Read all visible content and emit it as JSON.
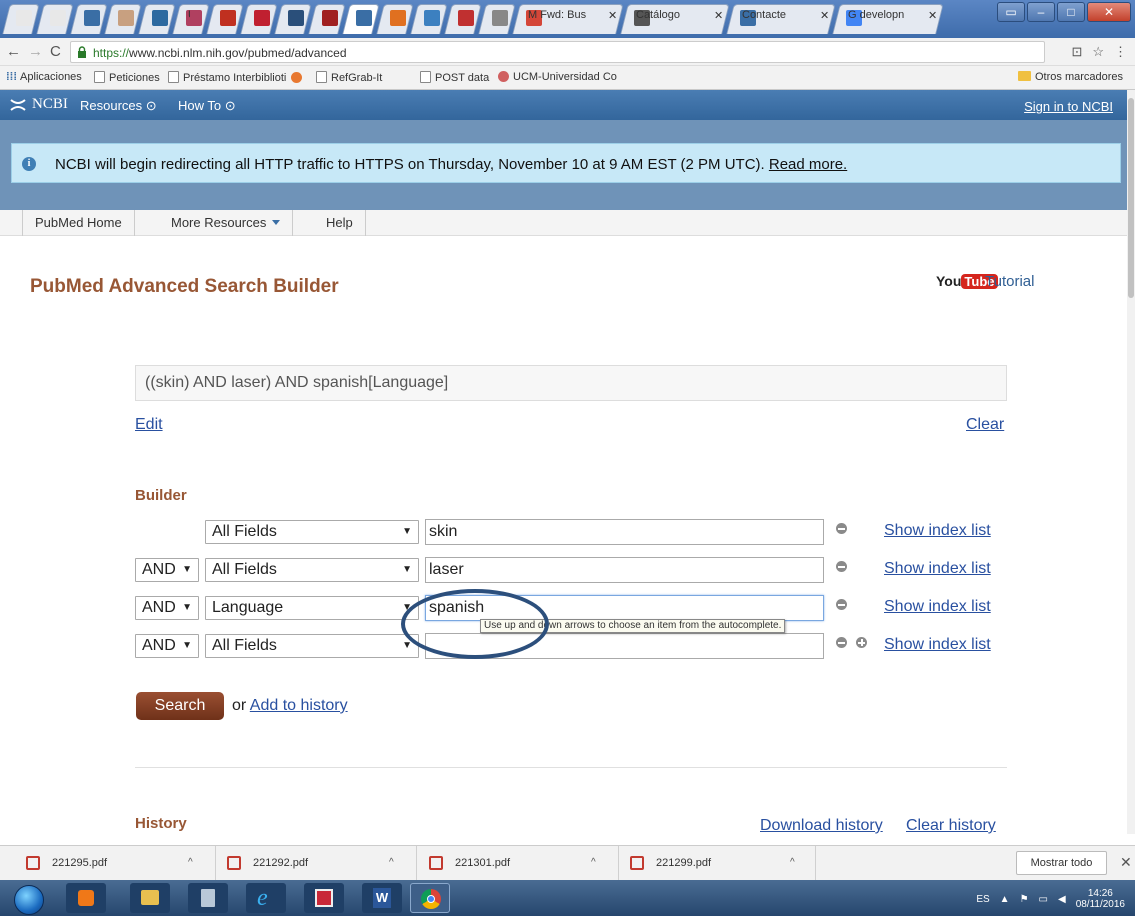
{
  "browser": {
    "tabs": [
      {
        "label": "",
        "color": "#e8e8e8"
      },
      {
        "label": "",
        "color": "#e8e8e8"
      },
      {
        "label": "",
        "color": "#3a6ea5"
      },
      {
        "label": "",
        "color": "#c8a080"
      },
      {
        "label": "",
        "color": "#2d6aa0"
      },
      {
        "label": "ULL",
        "color": "#b04060"
      },
      {
        "label": "",
        "color": "#c03020"
      },
      {
        "label": "",
        "color": "#c02030"
      },
      {
        "label": "",
        "color": "#2a4f7a"
      },
      {
        "label": "",
        "color": "#a02020"
      },
      {
        "label": "",
        "color": "#3a6ea5"
      },
      {
        "label": "",
        "color": "#e07020"
      },
      {
        "label": "",
        "color": "#3c80c0"
      },
      {
        "label": "",
        "color": "#c03030"
      },
      {
        "label": "",
        "color": "#888888"
      },
      {
        "label": "M Fwd: Bus",
        "color": "#d44638"
      },
      {
        "label": "Catálogo",
        "color": "#555555"
      },
      {
        "label": "Contacte",
        "color": "#3a6ea5"
      },
      {
        "label": "G developn",
        "color": "#4285f4"
      }
    ],
    "url_secure": "https://",
    "url_rest": "www.ncbi.nlm.nih.gov/pubmed/advanced",
    "bookmarks": {
      "apps": "Aplicaciones",
      "items": [
        "Peticiones",
        "Préstamo Interbiblioti",
        "RefGrab-It",
        "POST data",
        "UCM-Universidad Co"
      ],
      "other": "Otros marcadores"
    }
  },
  "ncbi": {
    "logo": "NCBI",
    "resources": "Resources",
    "howto": "How To",
    "signin": "Sign in to NCBI",
    "alert_text": "NCBI will begin redirecting all HTTP traffic to HTTPS on Thursday, November 10 at 9 AM EST (2 PM UTC).",
    "alert_link": "Read more.",
    "subnav": [
      "PubMed Home",
      "More Resources",
      "Help"
    ]
  },
  "main": {
    "title": "PubMed Advanced Search Builder",
    "youtube_you": "You",
    "youtube_tube": "Tube",
    "tutorial": "Tutorial",
    "query": "((skin) AND laser) AND spanish[Language]",
    "edit": "Edit",
    "clear": "Clear",
    "builder_heading": "Builder",
    "rows": [
      {
        "op": "",
        "field": "All Fields",
        "term": "skin",
        "index": "Show index list"
      },
      {
        "op": "AND",
        "field": "All Fields",
        "term": "laser",
        "index": "Show index list"
      },
      {
        "op": "AND",
        "field": "Language",
        "term": "spanish",
        "index": "Show index list"
      },
      {
        "op": "AND",
        "field": "All Fields",
        "term": "",
        "index": "Show index list"
      }
    ],
    "tooltip": "Use up and down arrows to choose an item from the autocomplete.",
    "search": "Search",
    "or": "or",
    "add_history": "Add to history",
    "history_heading": "History",
    "download_history": "Download history",
    "clear_history": "Clear history"
  },
  "downloads": {
    "files": [
      "221295.pdf",
      "221292.pdf",
      "221301.pdf",
      "221299.pdf"
    ],
    "show_all": "Mostrar todo"
  },
  "taskbar": {
    "lang": "ES",
    "time": "14:26",
    "date": "08/11/2016"
  }
}
